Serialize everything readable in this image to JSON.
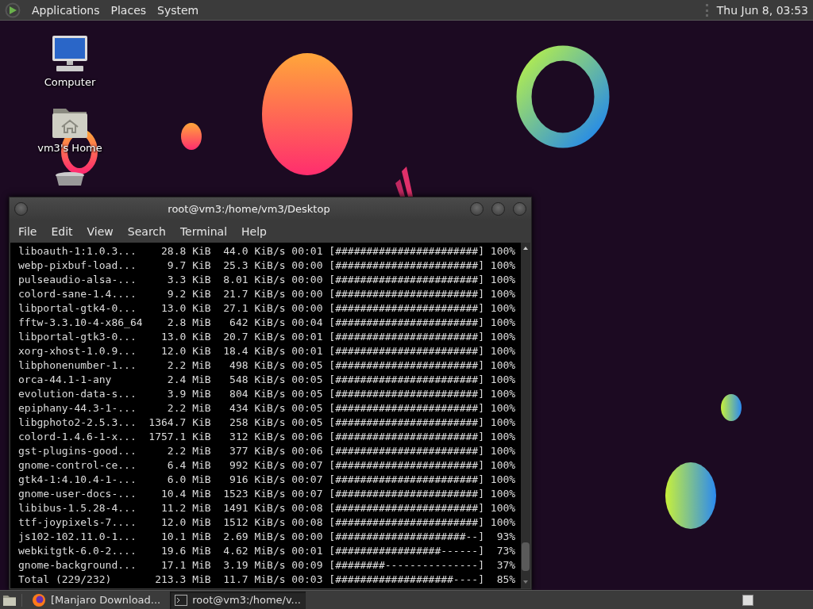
{
  "top_panel": {
    "menus": [
      "Applications",
      "Places",
      "System"
    ],
    "clock": "Thu Jun  8, 03:53"
  },
  "desktop_icons": [
    {
      "kind": "computer",
      "label": "Computer"
    },
    {
      "kind": "home",
      "label": "vm3's Home"
    },
    {
      "kind": "trash"
    }
  ],
  "terminal": {
    "title": "root@vm3:/home/vm3/Desktop",
    "menu": [
      "File",
      "Edit",
      "View",
      "Search",
      "Terminal",
      "Help"
    ],
    "lines": [
      "liboauth-1:1.0.3...    28.8 KiB  44.0 KiB/s 00:01 [#######################] 100%",
      "webp-pixbuf-load...     9.7 KiB  25.3 KiB/s 00:00 [#######################] 100%",
      "pulseaudio-alsa-...     3.3 KiB  8.01 KiB/s 00:00 [#######################] 100%",
      "colord-sane-1.4....     9.2 KiB  21.7 KiB/s 00:00 [#######################] 100%",
      "libportal-gtk4-0...    13.0 KiB  27.1 KiB/s 00:00 [#######################] 100%",
      "fftw-3.3.10-4-x86_64    2.8 MiB   642 KiB/s 00:04 [#######################] 100%",
      "libportal-gtk3-0...    13.0 KiB  20.7 KiB/s 00:01 [#######################] 100%",
      "xorg-xhost-1.0.9...    12.0 KiB  18.4 KiB/s 00:01 [#######################] 100%",
      "libphonenumber-1...     2.2 MiB   498 KiB/s 00:05 [#######################] 100%",
      "orca-44.1-1-any         2.4 MiB   548 KiB/s 00:05 [#######################] 100%",
      "evolution-data-s...     3.9 MiB   804 KiB/s 00:05 [#######################] 100%",
      "epiphany-44.3-1-...     2.2 MiB   434 KiB/s 00:05 [#######################] 100%",
      "libgphoto2-2.5.3...  1364.7 KiB   258 KiB/s 00:05 [#######################] 100%",
      "colord-1.4.6-1-x...  1757.1 KiB   312 KiB/s 00:06 [#######################] 100%",
      "gst-plugins-good...     2.2 MiB   377 KiB/s 00:06 [#######################] 100%",
      "gnome-control-ce...     6.4 MiB   992 KiB/s 00:07 [#######################] 100%",
      "gtk4-1:4.10.4-1-...     6.0 MiB   916 KiB/s 00:07 [#######################] 100%",
      "gnome-user-docs-...    10.4 MiB  1523 KiB/s 00:07 [#######################] 100%",
      "libibus-1.5.28-4...    11.2 MiB  1491 KiB/s 00:08 [#######################] 100%",
      "ttf-joypixels-7....    12.0 MiB  1512 KiB/s 00:08 [#######################] 100%",
      "js102-102.11.0-1...    10.1 MiB  2.69 MiB/s 00:00 [#####################--]  93%",
      "webkitgtk-6.0-2....    19.6 MiB  4.62 MiB/s 00:01 [#################------]  73%",
      "gnome-background...    17.1 MiB  3.19 MiB/s 00:09 [########---------------]  37%",
      "Total (229/232)       213.3 MiB  11.7 MiB/s 00:03 [###################----]  85%"
    ]
  },
  "taskbar": {
    "tasks": [
      {
        "kind": "browser",
        "label": "[Manjaro Download...",
        "selected": false
      },
      {
        "kind": "terminal",
        "label": "root@vm3:/home/v...",
        "selected": true
      }
    ]
  }
}
